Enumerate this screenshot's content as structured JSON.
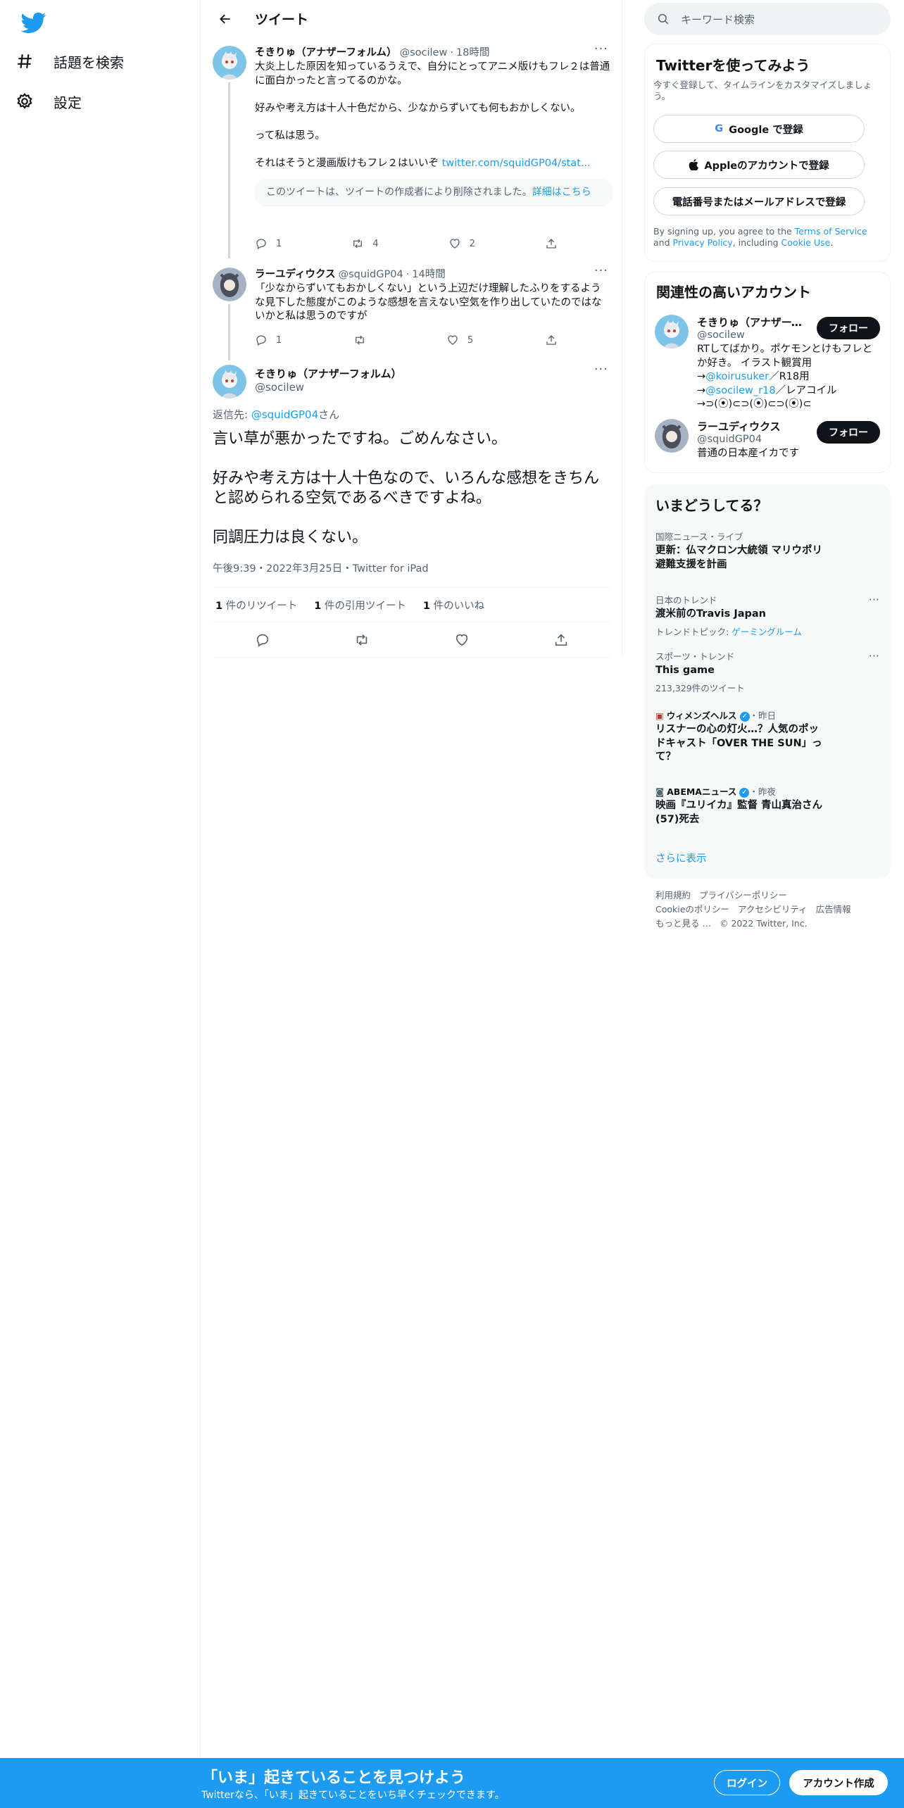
{
  "nav": {
    "explore_label": "話題を検索",
    "settings_label": "設定"
  },
  "header": {
    "title": "ツイート"
  },
  "thread": [
    {
      "name": "そきりゅ（アナザーフォルム）",
      "handle": "@socilew",
      "time": "18時間",
      "text": "大炎上した原因を知っているうえで、自分にとってアニメ版けもフレ２は普通に面白かったと言ってるのかな。\n\n好みや考え方は十人十色だから、少なからずいても何もおかしくない。\n\nって私は思う。\n\nそれはそうと漫画版けもフレ２はいいぞ",
      "link": "twitter.com/squidGP04/stat...",
      "quote_text": "このツイートは、ツイートの作成者により削除されました。",
      "quote_link": "詳細はこちら",
      "replies": "1",
      "retweets": "4",
      "likes": "2"
    },
    {
      "name": "ラーユディウクス",
      "handle": "@squidGP04",
      "time": "14時間",
      "text": "「少なからずいてもおかしくない」という上辺だけ理解したふりをするような見下した態度がこのような感想を言えない空気を作り出していたのではないかと私は思うのですが",
      "replies": "1",
      "retweets": "",
      "likes": "5"
    }
  ],
  "focus": {
    "name": "そきりゅ（アナザーフォルム）",
    "handle": "@socilew",
    "reply_prefix": "返信先:",
    "reply_handle": "@squidGP04",
    "reply_suffix": "さん",
    "text": "言い草が悪かったですね。ごめんなさい。\n\n好みや考え方は十人十色なので、いろんな感想をきちんと認められる空気であるべきですよね。\n\n同調圧力は良くない。",
    "meta": "午後9:39・2022年3月25日・Twitter for iPad",
    "stats": [
      {
        "count": "1",
        "label": "件のリツイート"
      },
      {
        "count": "1",
        "label": "件の引用ツイート"
      },
      {
        "count": "1",
        "label": "件のいいね"
      }
    ]
  },
  "search": {
    "placeholder": "キーワード検索"
  },
  "signup": {
    "title": "Twitterを使ってみよう",
    "subtitle": "今すぐ登録して、タイムラインをカスタマイズしましょう。",
    "google": "Google で登録",
    "apple": "Appleのアカウントで登録",
    "phone": "電話番号またはメールアドレスで登録",
    "terms_1": "By signing up, you agree to the ",
    "terms_link": "Terms of Service",
    "terms_2": " and ",
    "privacy_link": "Privacy Policy",
    "terms_3": ", including ",
    "cookie_link": "Cookie Use",
    "terms_4": "."
  },
  "related": {
    "title": "関連性の高いアカウント",
    "follow": "フォロー",
    "accounts": [
      {
        "name": "そきりゅ（アナザーフォルム）",
        "handle": "@socilew",
        "bio_1": "RTしてばかり。ポケモンとけもフレとか好き。 イラスト観賞用→",
        "bio_link1": "@koirusuker",
        "bio_2": "／R18用→",
        "bio_link2": "@socilew_r18",
        "bio_3": "／レアコイル→⊃(⦿)⊂⊃(⦿)⊂⊃(⦿)⊂"
      },
      {
        "name": "ラーユディウクス",
        "handle": "@squidGP04",
        "bio": "普通の日本産イカです"
      }
    ]
  },
  "trends": {
    "title": "いまどうしてる？",
    "items": [
      {
        "context": "国際ニュース・ライブ",
        "title": "更新：仏マクロン大統領 マリウポリ避難支援を計画"
      },
      {
        "context": "日本のトレンド",
        "title": "渡米前のTravis Japan",
        "sub_prefix": "トレンドトピック: ",
        "sub_link": "ゲーミングルーム"
      },
      {
        "context": "スポーツ・トレンド",
        "title": "This game",
        "sub": "213,329件のツイート"
      },
      {
        "source": "ウィメンズヘルス",
        "when": "・昨日",
        "title": "リスナーの心の灯火…？人気のポッドキャスト「OVER THE SUN」って？"
      },
      {
        "source": "ABEMAニュース",
        "when": "・昨夜",
        "title": "映画『ユリイカ』監督 青山真治さん(57)死去"
      }
    ],
    "more": "さらに表示"
  },
  "footer": {
    "links": [
      "利用規約",
      "プライバシーポリシー",
      "Cookieのポリシー",
      "アクセシビリティ",
      "広告情報",
      "もっと見る …"
    ],
    "copyright": "© 2022 Twitter, Inc."
  },
  "bottom_bar": {
    "title": "「いま」起きていることを見つけよう",
    "subtitle": "Twitterなら、「いま」起きていることをいち早くチェックできます。",
    "login": "ログイン",
    "signup": "アカウント作成"
  },
  "colors": {
    "accent": "#1d9bf0",
    "text": "#0f1419",
    "secondary": "#536471"
  }
}
